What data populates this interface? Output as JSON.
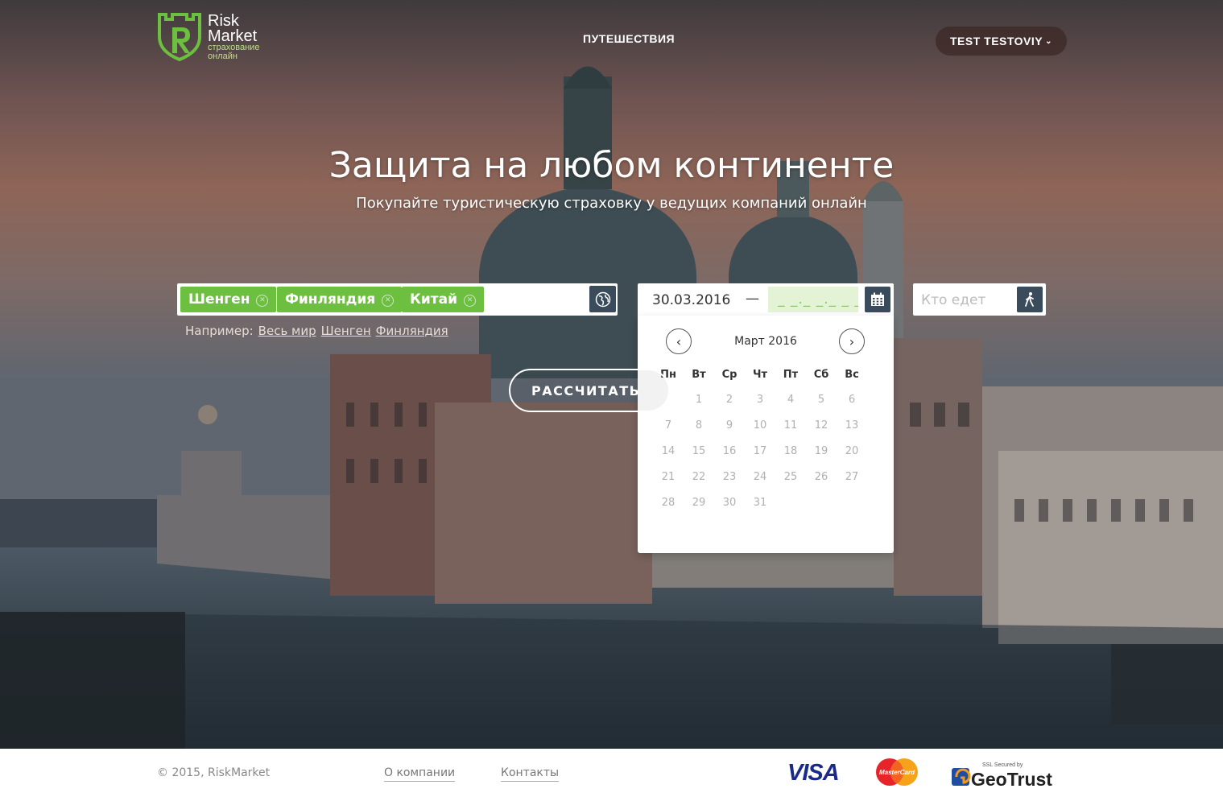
{
  "brand": {
    "name_line1": "Risk",
    "name_line2": "Market",
    "tagline_line1": "страхование",
    "tagline_line2": "онлайн"
  },
  "nav": {
    "travel_label": "ПУТЕШЕСТВИЯ",
    "user_label": "TEST TESTOVIY"
  },
  "hero": {
    "title": "Защита на любом континенте",
    "subtitle": "Покупайте туристическую страховку у ведущих компаний онлайн"
  },
  "search": {
    "countries": [
      "Шенген",
      "Финляндия",
      "Китай"
    ],
    "example_label": "Например:",
    "examples": [
      "Весь мир",
      "Шенген",
      "Финляндия"
    ],
    "date_from": "30.03.2016",
    "date_separator": "—",
    "date_to_mask": "_ _._ _._ _ _ _",
    "who_placeholder": "Кто едет",
    "calculate_label": "РАССЧИТАТЬ"
  },
  "calendar": {
    "title": "Март 2016",
    "weekdays": [
      "Пн",
      "Вт",
      "Ср",
      "Чт",
      "Пт",
      "Сб",
      "Вс"
    ],
    "first_weekday_offset": 1,
    "days_in_month": 31
  },
  "footer": {
    "copyright": "© 2015, RiskMarket",
    "about_label": "О компании",
    "contacts_label": "Контакты",
    "visa_label": "VISA",
    "mastercard_label": "MasterCard",
    "geotrust_small": "SSL Secured by",
    "geotrust_label": "GeoTrust"
  },
  "colors": {
    "accent_green": "#6cbf3f",
    "button_dark": "#3a4b5c"
  }
}
